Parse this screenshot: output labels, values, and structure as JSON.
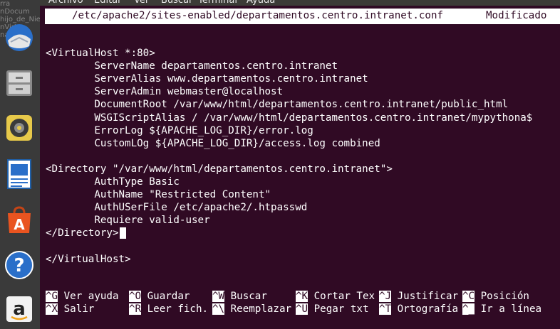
{
  "launcher": {
    "bg_text": "rra\nnDocum\nhijo_de_Nieve\nnVirtu\nnam",
    "icons": [
      {
        "name": "thunderbird-icon"
      },
      {
        "name": "files-icon"
      },
      {
        "name": "rhythmbox-icon"
      },
      {
        "name": "libreoffice-writer-icon"
      },
      {
        "name": "software-center-icon",
        "glyph": "A"
      },
      {
        "name": "help-icon",
        "glyph": "?"
      },
      {
        "name": "amazon-icon",
        "glyph": "a"
      }
    ]
  },
  "menubar": {
    "items": [
      "Archivo",
      "Editar",
      "Ver",
      "Buscar",
      "Terminal",
      "Ayuda"
    ]
  },
  "nano": {
    "file_path": "/etc/apache2/sites-enabled/departamentos.centro.intranet.conf",
    "status": "Modificado",
    "lines": [
      "",
      "<VirtualHost *:80>",
      "        ServerName departamentos.centro.intranet",
      "        ServerAlias www.departamentos.centro.intranet",
      "        ServerAdmin webmaster@localhost",
      "        DocumentRoot /var/www/html/departamentos.centro.intranet/public_html",
      "        WSGIScriptAlias / /var/www/html/departamentos.centro.intranet/mypythona$",
      "        ErrorLog ${APACHE_LOG_DIR}/error.log",
      "        CustomLOg ${APACHE_LOG_DIR}/access.log combined",
      "",
      "<Directory \"/var/www/html/departamentos.centro.intranet\">",
      "        AuthType Basic",
      "        AuthName \"Restricted Content\"",
      "        AuthUSerFile /etc/apache2/.htpasswd",
      "        Requiere valid-user",
      "</Directory>",
      "",
      "</VirtualHost>"
    ],
    "shortcuts_row1": [
      {
        "key": "^G",
        "label": " Ver ayuda"
      },
      {
        "key": "^O",
        "label": " Guardar"
      },
      {
        "key": "^W",
        "label": " Buscar"
      },
      {
        "key": "^K",
        "label": " Cortar Tex"
      },
      {
        "key": "^J",
        "label": " Justificar"
      },
      {
        "key": "^C",
        "label": " Posición"
      }
    ],
    "shortcuts_row2": [
      {
        "key": "^X",
        "label": " Salir"
      },
      {
        "key": "^R",
        "label": " Leer fich."
      },
      {
        "key": "^\\",
        "label": " Reemplazar"
      },
      {
        "key": "^U",
        "label": " Pegar txt"
      },
      {
        "key": "^T",
        "label": " Ortografía"
      },
      {
        "key": "^_",
        "label": " Ir a línea"
      }
    ]
  }
}
